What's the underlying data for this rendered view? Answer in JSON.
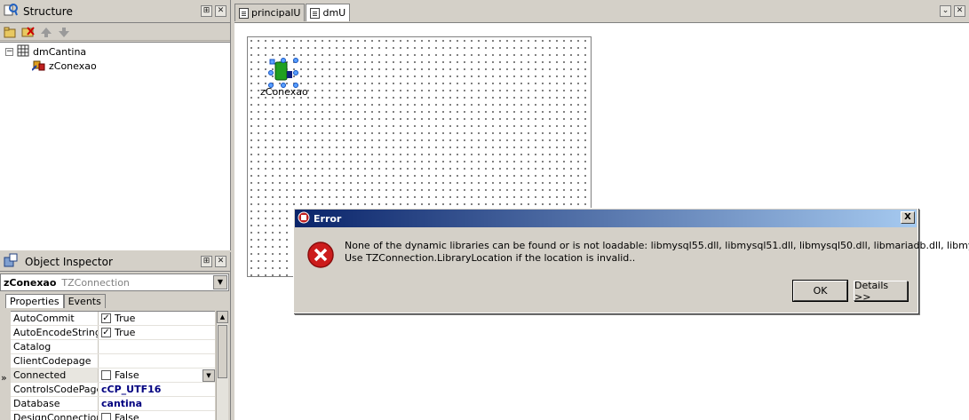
{
  "structure": {
    "title": "Structure",
    "tree": {
      "root_label": "dmCantina",
      "root_expander": "−",
      "child_label": "zConexao"
    }
  },
  "inspector": {
    "title": "Object Inspector",
    "component_name": "zConexao",
    "component_type": "TZConnection",
    "tabs": [
      "Properties",
      "Events"
    ],
    "properties": [
      {
        "name": "AutoCommit",
        "value": "True",
        "checkbox": true,
        "checked": true
      },
      {
        "name": "AutoEncodeStrings",
        "value": "True",
        "checkbox": true,
        "checked": true
      },
      {
        "name": "Catalog",
        "value": "",
        "checkbox": false
      },
      {
        "name": "ClientCodepage",
        "value": "",
        "checkbox": false
      },
      {
        "name": "Connected",
        "value": "False",
        "checkbox": true,
        "checked": false,
        "selected": true
      },
      {
        "name": "ControlsCodePage",
        "value": "cCP_UTF16",
        "checkbox": false,
        "emphasis": true
      },
      {
        "name": "Database",
        "value": "cantina",
        "checkbox": false,
        "emphasis": true
      },
      {
        "name": "DesignConnection",
        "value": "False",
        "checkbox": true,
        "checked": false
      }
    ],
    "current_marker": "»"
  },
  "editor": {
    "tabs": [
      {
        "label": "principalU",
        "active": false
      },
      {
        "label": "dmU",
        "active": true
      }
    ],
    "component_label": "zConexao"
  },
  "dialog": {
    "title": "Error",
    "close_glyph": "X",
    "message_line1": "None of the dynamic libraries can be found or is not loadable: libmysql55.dll, libmysql51.dll, libmysql50.dll, libmariadb.dll, libmysql.dll !",
    "message_line2": "Use TZConnection.LibraryLocation if the location is invalid..",
    "ok_label": "OK",
    "details_label": "Details >>"
  },
  "colors": {
    "titlebar_start": "#0a246a",
    "titlebar_end": "#a6caf0",
    "error_red": "#cc1c1c"
  }
}
